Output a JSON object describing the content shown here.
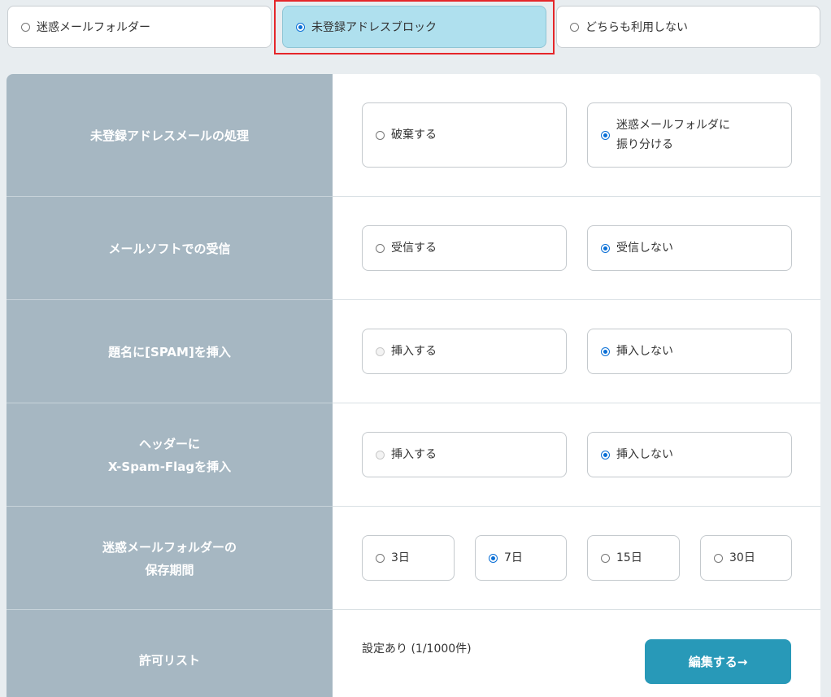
{
  "mode_selector": {
    "options": [
      {
        "label": "迷惑メールフォルダー",
        "selected": false
      },
      {
        "label": "未登録アドレスブロック",
        "selected": true
      },
      {
        "label": "どちらも利用しない",
        "selected": false
      }
    ]
  },
  "settings": {
    "unregistered_handling": {
      "label": "未登録アドレスメールの処理",
      "options": [
        {
          "label": "破棄する",
          "selected": false
        },
        {
          "label_line1": "迷惑メールフォルダに",
          "label_line2": "振り分ける",
          "selected": true
        }
      ]
    },
    "mail_software_receive": {
      "label": "メールソフトでの受信",
      "options": [
        {
          "label": "受信する",
          "selected": false
        },
        {
          "label": "受信しない",
          "selected": true
        }
      ]
    },
    "subject_spam_insert": {
      "label": "題名に[SPAM]を挿入",
      "options": [
        {
          "label": "挿入する",
          "selected": false,
          "disabled": true
        },
        {
          "label": "挿入しない",
          "selected": true
        }
      ]
    },
    "header_spam_flag": {
      "label_line1": "ヘッダーに",
      "label_line2": "X-Spam-Flagを挿入",
      "options": [
        {
          "label": "挿入する",
          "selected": false,
          "disabled": true
        },
        {
          "label": "挿入しない",
          "selected": true
        }
      ]
    },
    "retention_period": {
      "label_line1": "迷惑メールフォルダーの",
      "label_line2": "保存期間",
      "options": [
        {
          "label": "3日",
          "selected": false
        },
        {
          "label": "7日",
          "selected": true
        },
        {
          "label": "15日",
          "selected": false
        },
        {
          "label": "30日",
          "selected": false
        }
      ]
    },
    "allow_list": {
      "label": "許可リスト",
      "status": "設定あり (1/1000件)",
      "edit_label": "編集する→"
    }
  },
  "colors": {
    "selected_mode_bg": "#afe0ee",
    "label_column_bg": "#a6b7c2",
    "edit_button_bg": "#2899b8",
    "highlight_border": "#e5262a",
    "radio_checked": "#0a6fd6"
  }
}
